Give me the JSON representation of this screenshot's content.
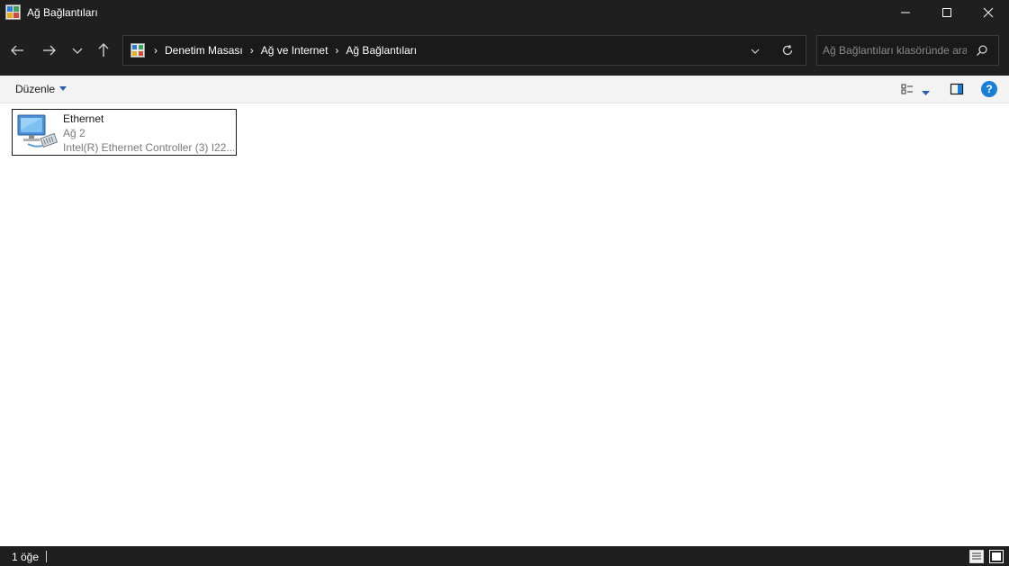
{
  "window": {
    "title": "Ağ Bağlantıları",
    "icon": "network-connections-icon"
  },
  "navigation": {
    "breadcrumbs": [
      "Denetim Masası",
      "Ağ ve Internet",
      "Ağ Bağlantıları"
    ]
  },
  "search": {
    "placeholder": "Ağ Bağlantıları klasöründe ara",
    "value": ""
  },
  "toolbar": {
    "organize_label": "Düzenle",
    "help_label": "?"
  },
  "items": [
    {
      "name": "Ethernet",
      "network": "Ağ 2",
      "adapter": "Intel(R) Ethernet Controller (3) I22..."
    }
  ],
  "status": {
    "item_count": "1 öğe"
  },
  "colors": {
    "dark_chrome": "#1f1f1f",
    "command_bar": "#f3f3f3",
    "accent": "#1a7fd6"
  }
}
